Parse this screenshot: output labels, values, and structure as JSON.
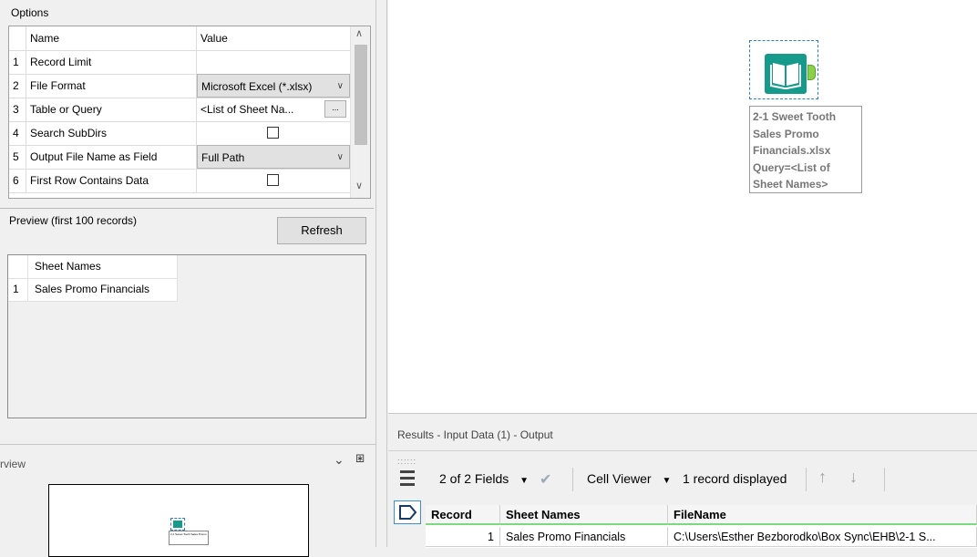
{
  "options": {
    "label": "Options",
    "header": {
      "name": "Name",
      "value": "Value"
    },
    "rows": [
      {
        "num": "1",
        "name": "Record Limit",
        "value": ""
      },
      {
        "num": "2",
        "name": "File Format",
        "value": "Microsoft Excel (*.xlsx)"
      },
      {
        "num": "3",
        "name": "Table or Query",
        "value": "<List of Sheet Na...",
        "button": "..."
      },
      {
        "num": "4",
        "name": "Search SubDirs",
        "value": ""
      },
      {
        "num": "5",
        "name": "Output File Name as Field",
        "value": "Full Path"
      },
      {
        "num": "6",
        "name": "First Row Contains Data",
        "value": ""
      }
    ]
  },
  "preview": {
    "label": "Preview (first 100 records)",
    "refresh": "Refresh",
    "header": "Sheet Names",
    "rows": [
      {
        "num": "1",
        "value": "Sales Promo Financials"
      }
    ]
  },
  "overview": {
    "title": "rview",
    "mini_label": "2-1 Sweet Tooth Sales Promo"
  },
  "canvas": {
    "tool_annotation": "2-1 Sweet Tooth\nSales Promo\nFinancials.xlsx\nQuery=<List of\nSheet Names>"
  },
  "results": {
    "title": "Results - Input Data (1) - Output",
    "fields": "2 of 2 Fields",
    "cell_viewer": "Cell Viewer",
    "records_displayed": "1 record displayed",
    "columns": [
      "Record",
      "Sheet Names",
      "FileName"
    ],
    "rows": [
      {
        "record": "1",
        "sheet": "Sales Promo Financials",
        "file": "C:\\Users\\Esther Bezborodko\\Box Sync\\EHB\\2-1 S..."
      }
    ]
  },
  "colors": {
    "tool": "#169a8c",
    "anchor": "#8bd148",
    "header_underline": "#7dd97d"
  },
  "icons": [
    "book-icon",
    "chevron-down-icon",
    "pin-icon",
    "check-icon",
    "up-arrow-icon",
    "down-arrow-icon",
    "list-icon",
    "tag-icon"
  ]
}
